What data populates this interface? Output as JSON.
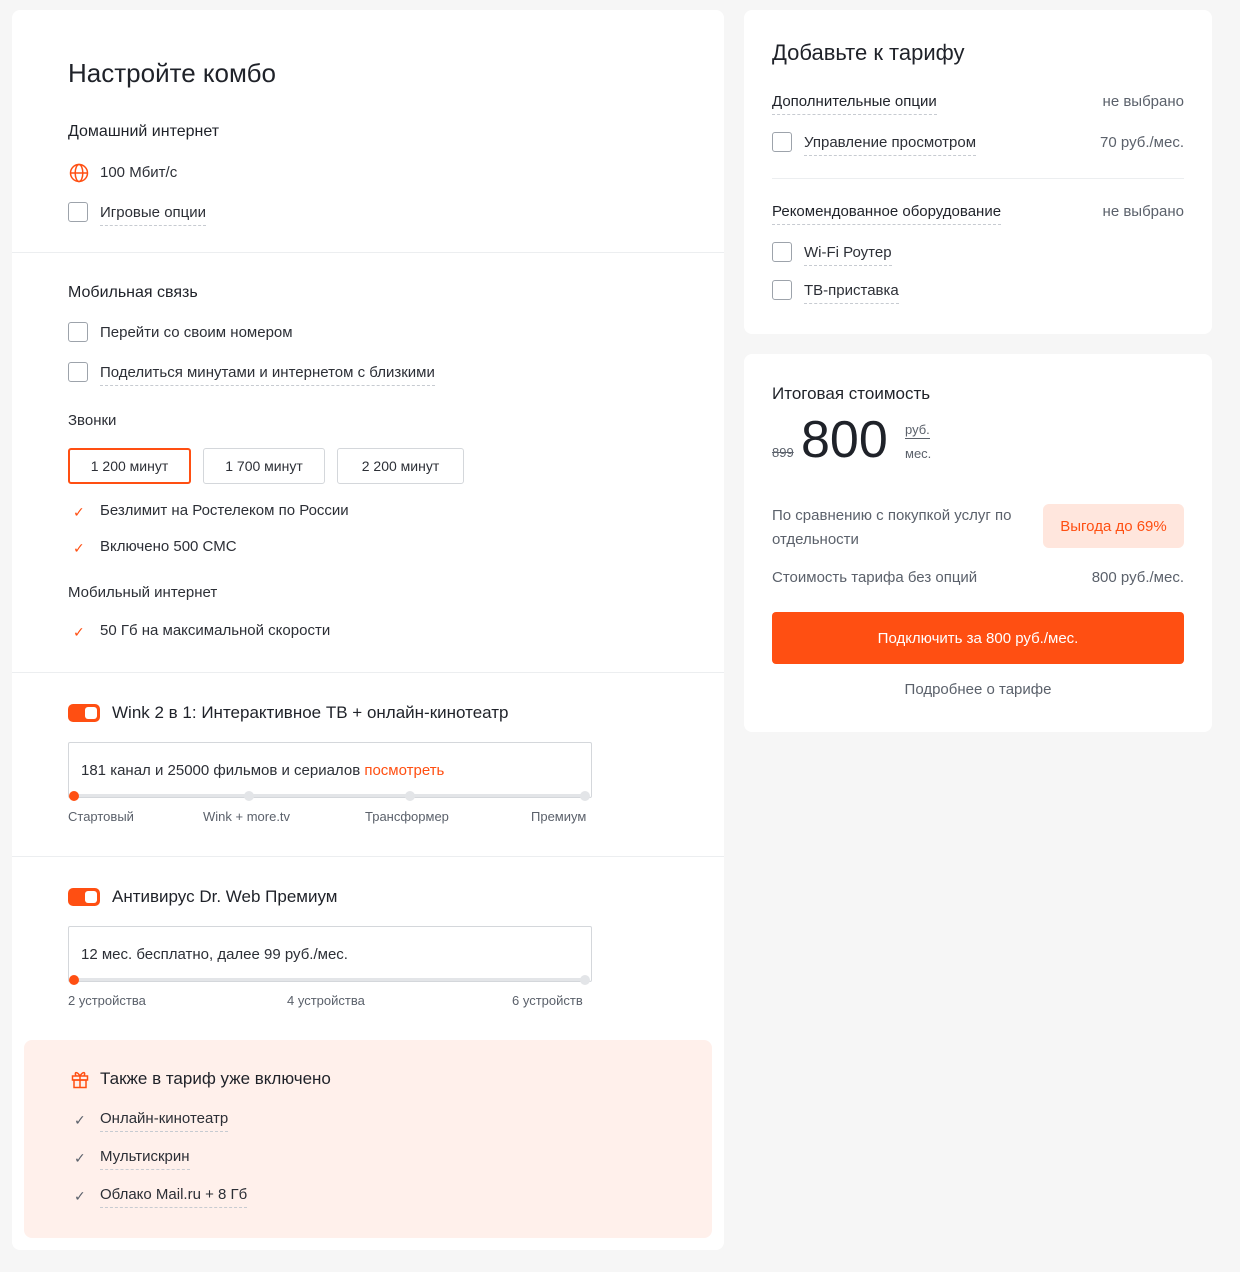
{
  "configure": {
    "title": "Настройте комбо",
    "home_internet": {
      "heading": "Домашний интернет",
      "speed": "100 Мбит/с",
      "gaming_option": "Игровые опции"
    },
    "mobile": {
      "heading": "Мобильная связь",
      "keep_number": "Перейти со своим номером",
      "share": "Поделиться минутами и интернетом с близкими",
      "calls_heading": "Звонки",
      "minutes_options": [
        "1 200 минут",
        "1 700 минут",
        "2 200 минут"
      ],
      "selected_minutes": "1 200 минут",
      "features": [
        "Безлимит на Ростелеком по России",
        "Включено 500 СМС"
      ],
      "internet_heading": "Мобильный интернет",
      "internet_features": [
        "50 Гб на максимальной скорости"
      ]
    },
    "wink": {
      "title": "Wink 2 в 1: Интерактивное ТВ + онлайн-кинотеатр",
      "enabled": true,
      "description": "181 канал и 25000 фильмов и сериалов",
      "link": "посмотреть",
      "levels": [
        "Стартовый",
        "Wink + more.tv",
        "Трансформер",
        "Премиум"
      ],
      "selected_level": "Стартовый"
    },
    "antivirus": {
      "title": "Антивирус Dr. Web Премиум",
      "enabled": true,
      "description": "12 мес. бесплатно, далее 99 руб./мес.",
      "levels": [
        "2 устройства",
        "4 устройства",
        "6 устройств"
      ],
      "selected_level": "2 устройства"
    },
    "included": {
      "heading": "Также в тариф уже включено",
      "items": [
        "Онлайн-кинотеатр",
        "Мультискрин",
        "Облако Mail.ru + 8 Гб"
      ]
    }
  },
  "addons": {
    "title": "Добавьте к тарифу",
    "options": {
      "heading": "Дополнительные опции",
      "status": "не выбрано",
      "items": [
        {
          "label": "Управление просмотром",
          "price": "70 руб./мес."
        }
      ]
    },
    "equipment": {
      "heading": "Рекомендованное оборудование",
      "status": "не выбрано",
      "items": [
        "Wi-Fi Роутер",
        "ТВ-приставка"
      ]
    }
  },
  "total": {
    "heading": "Итоговая стоимость",
    "old_price": "899",
    "price": "800",
    "unit_top": "руб.",
    "unit_bottom": "мес.",
    "comparison": "По сравнению с покупкой услуг по отдельности",
    "benefit": "Выгода до 69%",
    "base_label": "Стоимость тарифа без опций",
    "base_value": "800 руб./мес.",
    "cta": "Подключить за 800 руб./мес.",
    "details": "Подробнее о тарифе"
  },
  "colors": {
    "accent": "#ff4f12",
    "benefit_bg": "#ffe6dd",
    "gift_bg": "#fff0eb"
  }
}
